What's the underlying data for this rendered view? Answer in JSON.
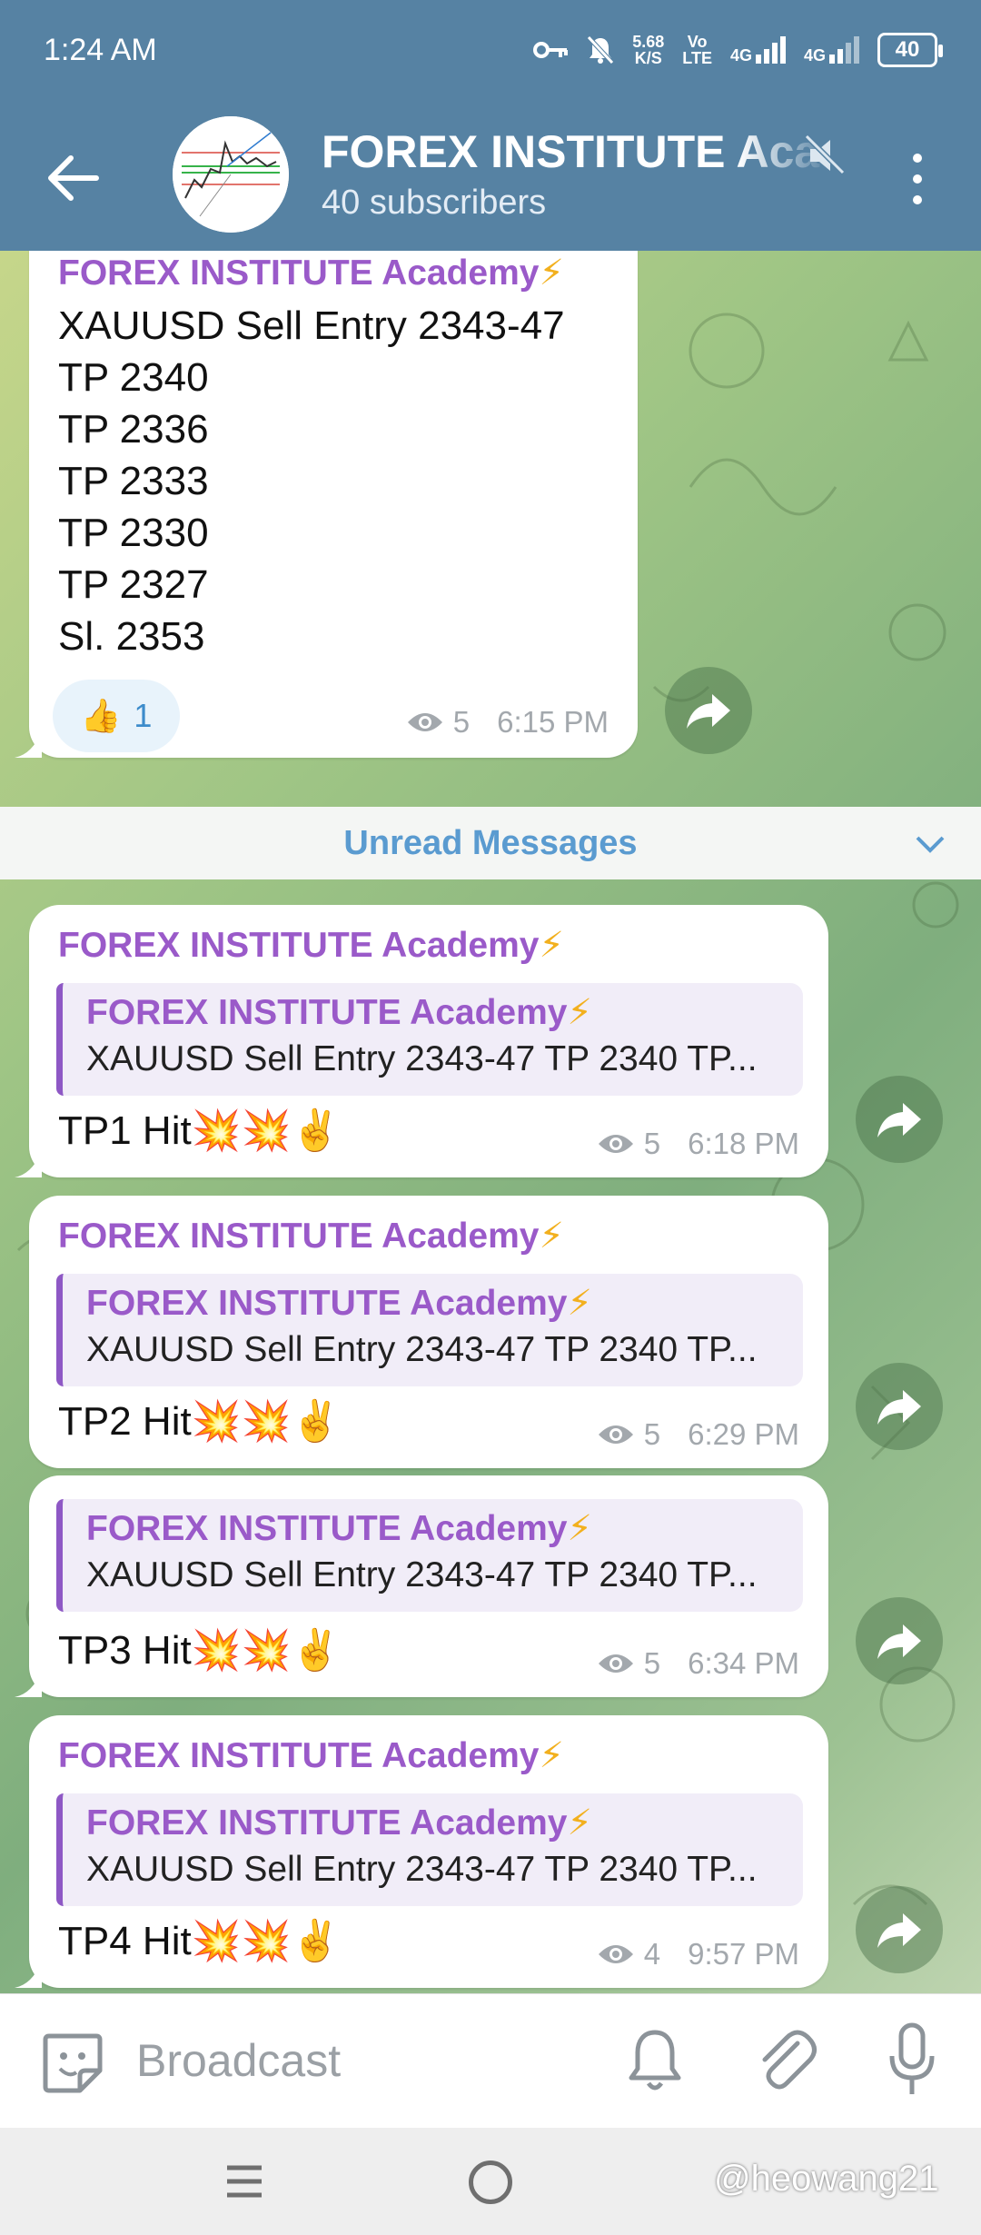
{
  "status_bar": {
    "time": "1:24 AM",
    "speed_value": "5.68",
    "speed_unit": "K/S",
    "volte_top": "Vo",
    "volte_bottom": "LTE",
    "net1": "4G",
    "net2": "4G",
    "battery": "40"
  },
  "header": {
    "title": "FOREX INSTITUTE Academy",
    "subtitle": "40 subscribers"
  },
  "channel_name": "FOREX INSTITUTE Academy",
  "bolt": "⚡",
  "first_message": {
    "lines": [
      "XAUUSD Sell Entry 2343-47",
      "TP 2340",
      "TP 2336",
      "TP 2333",
      "TP 2330",
      "TP 2327",
      "Sl. 2353"
    ],
    "reaction_emoji": "👍",
    "reaction_count": "1",
    "views": "5",
    "time": "6:15 PM"
  },
  "unread_label": "Unread Messages",
  "reply_preview": "XAUUSD Sell Entry 2343-47 TP 2340 TP...",
  "replies": [
    {
      "text": "TP1 Hit💥💥✌️",
      "views": "5",
      "time": "6:18 PM"
    },
    {
      "text": "TP2 Hit💥💥✌️",
      "views": "5",
      "time": "6:29 PM"
    },
    {
      "text": "TP3 Hit💥💥✌️",
      "views": "5",
      "time": "6:34 PM"
    },
    {
      "text": "TP4 Hit💥💥✌️",
      "views": "4",
      "time": "9:57 PM"
    }
  ],
  "composer": {
    "placeholder": "Broadcast"
  },
  "watermark": "@heowang21",
  "colors": {
    "header": "#5682a3",
    "sender": "#9a5ac9",
    "link": "#5a9bd0"
  }
}
